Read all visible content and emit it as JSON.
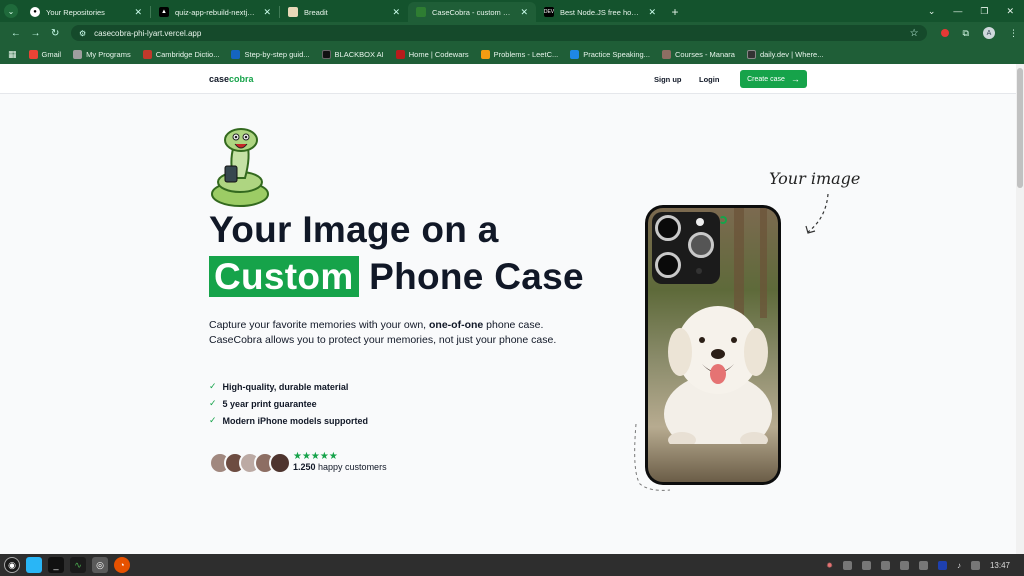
{
  "browser": {
    "tabs": [
      {
        "title": "Your Repositories",
        "favicon": "github-icon",
        "active": false
      },
      {
        "title": "quiz-app-rebuild-nextjs - Ov",
        "favicon": "vercel-icon",
        "active": false
      },
      {
        "title": "Breadit",
        "favicon": "breadit-icon",
        "active": false
      },
      {
        "title": "CaseCobra - custom high-q",
        "favicon": "casecobra-icon",
        "active": true
      },
      {
        "title": "Best Node.JS free hosting s",
        "favicon": "dev-icon",
        "active": false
      }
    ],
    "url": "casecobra-phi-lyart.vercel.app",
    "bookmarks": [
      {
        "label": "Gmail",
        "color": "#ea4335"
      },
      {
        "label": "My Programs",
        "color": "#9e9e9e"
      },
      {
        "label": "Cambridge Dictio...",
        "color": "#c0392b"
      },
      {
        "label": "Step-by-step guid...",
        "color": "#1565c0"
      },
      {
        "label": "BLACKBOX AI",
        "color": "#111111"
      },
      {
        "label": "Home | Codewars",
        "color": "#b71c1c"
      },
      {
        "label": "Problems - LeetC...",
        "color": "#f39c12"
      },
      {
        "label": "Practice Speaking...",
        "color": "#1e88e5"
      },
      {
        "label": "Courses - Manara",
        "color": "#8d6e63"
      },
      {
        "label": "daily.dev | Where...",
        "color": "#333333"
      }
    ],
    "avatar_letter": "A"
  },
  "site": {
    "logo_prefix": "case",
    "logo_suffix": "cobra",
    "nav": {
      "signup": "Sign up",
      "login": "Login",
      "create": "Create case"
    },
    "hero": {
      "line1": "Your Image on a",
      "highlight": "Custom",
      "line2_rest": "Phone Case",
      "desc_part1": "Capture your favorite memories with your own, ",
      "desc_bold": "one-of-one",
      "desc_part2": " phone case. CaseCobra allows you to protect your memories, not just your phone case.",
      "features": [
        "High-quality, durable material",
        "5 year print guarantee",
        "Modern iPhone models supported"
      ],
      "stars": "★★★★★",
      "customer_count": "1.250",
      "customer_text": " happy customers",
      "your_image": "Your image"
    }
  },
  "taskbar": {
    "time": "13:47"
  },
  "colors": {
    "brand_green": "#16a34a",
    "browser_dark": "#14532d"
  }
}
